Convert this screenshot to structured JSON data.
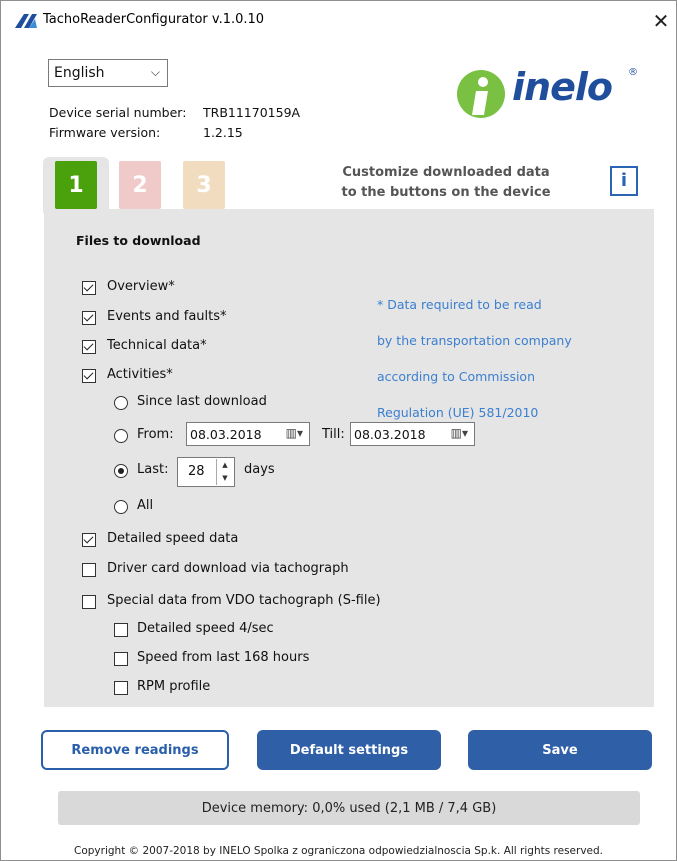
{
  "window": {
    "title": "TachoReaderConfigurator v.1.0.10",
    "close_glyph": "✕",
    "app_icon": "tacho-app-icon"
  },
  "language": {
    "selected": "English"
  },
  "device": {
    "serial_label": "Device serial number:",
    "serial_value": "TRB11170159A",
    "firmware_label": "Firmware version:",
    "firmware_value": "1.2.15"
  },
  "logo": {
    "text": "inelo",
    "registered": "®"
  },
  "tabs": [
    {
      "label": "1",
      "active": true,
      "color": "#4aa10b"
    },
    {
      "label": "2",
      "active": false,
      "color": "#f0c9c9"
    },
    {
      "label": "3",
      "active": false,
      "color": "#f2dcbf"
    }
  ],
  "header_caption": {
    "line1": "Customize downloaded data",
    "line2": "to the buttons on the device"
  },
  "info_button": {
    "glyph": "i"
  },
  "files": {
    "title": "Files to download",
    "overview": "Overview*",
    "events": "Events and faults*",
    "technical": "Technical data*",
    "activities": "Activities*",
    "note_lines": [
      "* Data required to be read",
      "by the transportation company",
      "according to Commission",
      "Regulation (UE) 581/2010"
    ],
    "since_last": "Since last download",
    "from_label": "From:",
    "from_value": "08.03.2018",
    "till_label": "Till:",
    "till_value": "08.03.2018",
    "last_label": "Last:",
    "last_value": "28",
    "days_label": "days",
    "all_label": "All",
    "detailed_speed": "Detailed speed data",
    "driver_card": "Driver card download via tachograph",
    "special_vdo": "Special data from VDO tachograph (S-file)",
    "speed_4sec": "Detailed speed 4/sec",
    "speed_168": "Speed from last 168 hours",
    "rpm": "RPM profile"
  },
  "buttons": {
    "remove": "Remove readings",
    "default": "Default settings",
    "save": "Save"
  },
  "memory": {
    "text": "Device memory: 0,0% used (2,1 MB / 7,4 GB)"
  },
  "copyright": "Copyright © 2007-2018 by INELO Spolka z ograniczona odpowiedzialnoscia Sp.k. All rights reserved.",
  "colors": {
    "accent_blue": "#2f5fa7",
    "logo_green": "#7ac143",
    "logo_blue": "#1e4e9c",
    "note_blue": "#3b7fd1"
  }
}
